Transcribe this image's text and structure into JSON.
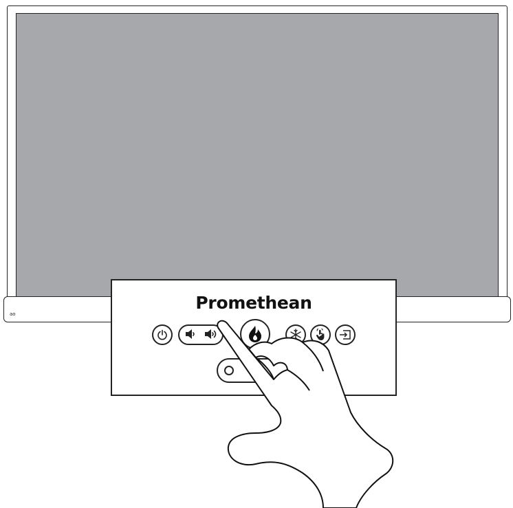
{
  "brand": {
    "name": "Promethean"
  },
  "bezel": {
    "mark": "ао"
  },
  "panel_buttons": [
    {
      "name": "power",
      "icon": "power-icon"
    },
    {
      "name": "volume-down",
      "icon": "volume-down-icon"
    },
    {
      "name": "volume-up",
      "icon": "volume-up-icon"
    },
    {
      "name": "home",
      "icon": "promethean-flame-icon"
    },
    {
      "name": "freeze",
      "icon": "snowflake-icon"
    },
    {
      "name": "touch-lock",
      "icon": "touch-hand-icon"
    },
    {
      "name": "input",
      "icon": "input-source-icon"
    }
  ],
  "colors": {
    "screen": "#a7a8ab",
    "outline": "#222222"
  }
}
